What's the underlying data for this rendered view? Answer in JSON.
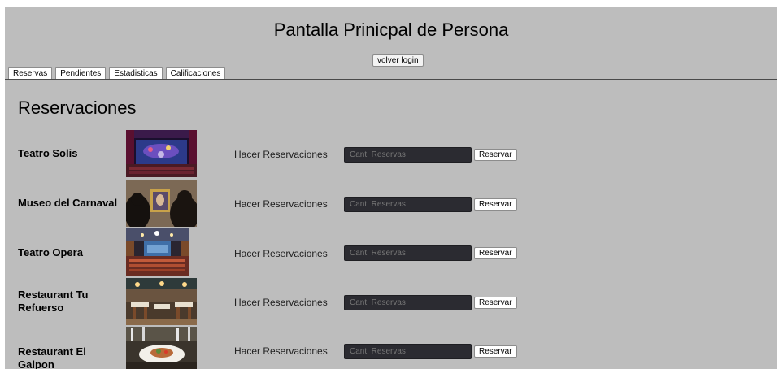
{
  "header": {
    "title": "Pantalla Prinicpal de Persona",
    "volver_label": "volver login"
  },
  "tabs": [
    {
      "label": "Reservas"
    },
    {
      "label": "Pendientes"
    },
    {
      "label": "Estadisticas"
    },
    {
      "label": "Calificaciones"
    }
  ],
  "main": {
    "title": "Reservaciones",
    "rows": [
      {
        "name": "Teatro Solis",
        "action_label": "Hacer Reservaciones",
        "placeholder": "Cant. Reservas",
        "button_label": "Reservar",
        "image": "theater-stage-photo"
      },
      {
        "name": "Museo del Carnaval",
        "action_label": "Hacer Reservaciones",
        "placeholder": "Cant. Reservas",
        "button_label": "Reservar",
        "image": "museum-visitors-photo"
      },
      {
        "name": "Teatro Opera",
        "action_label": "Hacer Reservaciones",
        "placeholder": "Cant. Reservas",
        "button_label": "Reservar",
        "image": "opera-hall-photo"
      },
      {
        "name": "Restaurant Tu Refuerso",
        "action_label": "Hacer Reservaciones",
        "placeholder": "Cant. Reservas",
        "button_label": "Reservar",
        "image": "restaurant-interior-photo"
      },
      {
        "name": "Restaurant El Galpon",
        "action_label": "Hacer Reservaciones",
        "placeholder": "Cant. Reservas",
        "button_label": "Reservar",
        "image": "restaurant-dish-photo"
      }
    ]
  },
  "colors": {
    "page_background": "#bdbdbd",
    "input_background": "#2b2b31"
  }
}
